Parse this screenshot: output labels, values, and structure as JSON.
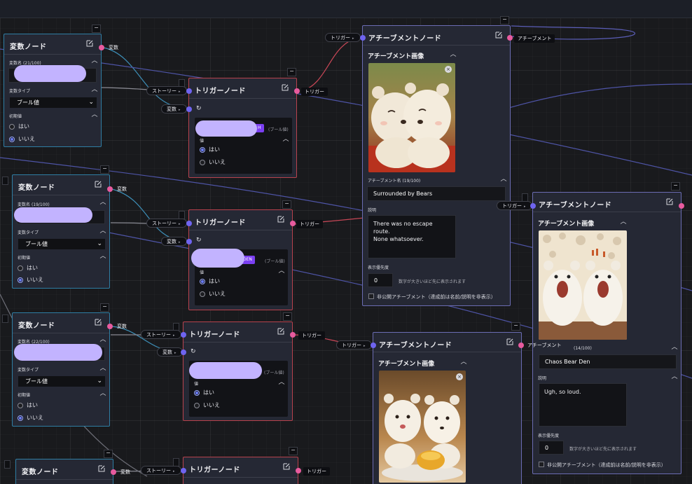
{
  "labels": {
    "var_node_title": "変数ノード",
    "trigger_node_title": "トリガーノード",
    "achievement_node_title": "アチーブメントノード",
    "variable_name": "変数名",
    "variable_type": "変数タイプ",
    "initial_value": "初期値",
    "yes": "はい",
    "no": "いいえ",
    "value": "値",
    "bool_type": "ブール値",
    "bool_note": "(ブール値)",
    "story_pin": "ストーリー",
    "variable_pin": "変数",
    "trigger_pin": "トリガー",
    "variable_out": "変数",
    "trigger_out": "トリガー",
    "achievement_out": "アチーブメント",
    "achievement_image": "アチーブメント画像",
    "achievement_name": "アチーブメント名",
    "description": "説明",
    "display_priority": "表示優先度",
    "priority_note": "数字が大きいほど先に表示されます",
    "hidden_achievement": "非公開アチーブメント（達成前は名前/説明を非表示）",
    "collapse": "−"
  },
  "variable_nodes": [
    {
      "name_count": "(21/100)",
      "type_value": "ブール値",
      "selected": "no"
    },
    {
      "name_count": "(19/100)",
      "type_value": "ブール値",
      "selected": "no"
    },
    {
      "name_count": "(22/100)",
      "type_value": "ブール値",
      "selected": "no"
    },
    {
      "name_count": ""
    }
  ],
  "trigger_nodes": [
    {
      "tag": "H",
      "selected": "yes"
    },
    {
      "tag": "DEN",
      "selected": "yes"
    },
    {
      "tag": "",
      "selected": "yes"
    },
    {
      "tag": ""
    }
  ],
  "achievement_nodes": [
    {
      "name_count": "(19/100)",
      "name_value": "Surrounded by Bears",
      "description_value": "There was no escape route.\nNone whatsoever.",
      "priority_value": "0",
      "image": "two-hugging-white-bears"
    },
    {
      "name_count": "(14/100)",
      "name_value": "Chaos Bear Den",
      "description_value": "Ugh, so loud.",
      "priority_value": "0",
      "image": "two-screaming-white-bears"
    },
    {
      "image": "two-bears-with-honey"
    }
  ],
  "colors": {
    "trigger_pin": "#e85b9e",
    "input_pin": "#6f64f0",
    "variable_border": "#2f7ea4",
    "trigger_border": "#b8424d",
    "achievement_border": "#6b6cb3",
    "canvas": "#191a1d",
    "highlight": "#c2b3ff"
  }
}
